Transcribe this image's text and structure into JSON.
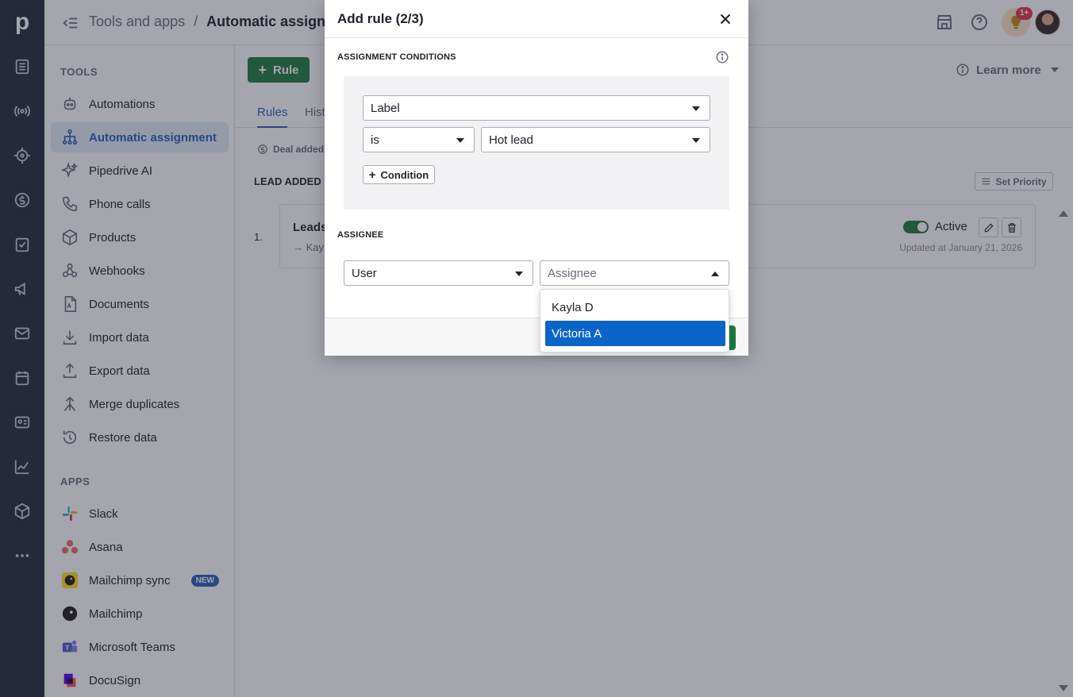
{
  "app": {
    "logo": "p"
  },
  "header": {
    "breadcrumb_parent": "Tools and apps",
    "breadcrumb_sep": "/",
    "breadcrumb_current": "Automatic assignmen",
    "notification_badge": "1+"
  },
  "sidenav": {
    "tools_heading": "TOOLS",
    "apps_heading": "APPS",
    "tools": [
      {
        "label": "Automations",
        "icon": "robot-icon"
      },
      {
        "label": "Automatic assignment",
        "icon": "assignment-tree-icon",
        "active": true
      },
      {
        "label": "Pipedrive AI",
        "icon": "sparkle-icon"
      },
      {
        "label": "Phone calls",
        "icon": "phone-icon"
      },
      {
        "label": "Products",
        "icon": "box-icon"
      },
      {
        "label": "Webhooks",
        "icon": "webhook-icon"
      },
      {
        "label": "Documents",
        "icon": "document-icon"
      },
      {
        "label": "Import data",
        "icon": "download-icon"
      },
      {
        "label": "Export data",
        "icon": "upload-icon"
      },
      {
        "label": "Merge duplicates",
        "icon": "merge-icon"
      },
      {
        "label": "Restore data",
        "icon": "restore-icon"
      }
    ],
    "apps": [
      {
        "label": "Slack",
        "icon": "slack-icon"
      },
      {
        "label": "Asana",
        "icon": "asana-icon"
      },
      {
        "label": "Mailchimp sync",
        "icon": "mailchimp-icon",
        "badge": "NEW"
      },
      {
        "label": "Mailchimp",
        "icon": "mailchimp-icon"
      },
      {
        "label": "Microsoft Teams",
        "icon": "teams-icon"
      },
      {
        "label": "DocuSign",
        "icon": "docusign-icon"
      }
    ]
  },
  "main": {
    "add_rule_label": "Rule",
    "learn_more": "Learn more",
    "tabs": [
      "Rules",
      "Hist"
    ],
    "deal_added": "Deal added",
    "lead_added_heading": "LEAD ADDED",
    "set_priority": "Set Priority",
    "rule": {
      "number": "1.",
      "title": "Leads",
      "sub": "Kay",
      "status": "Active",
      "updated": "Updated at January 21, 2026"
    }
  },
  "modal": {
    "title": "Add rule (2/3)",
    "conditions_heading": "ASSIGNMENT CONDITIONS",
    "field_select": "Label",
    "operator_select": "is",
    "value_select": "Hot lead",
    "add_condition": "Condition",
    "assignee_heading": "ASSIGNEE",
    "assignee_type": "User",
    "assignee_placeholder": "Assignee",
    "options": [
      "Kayla D",
      "Victoria A"
    ],
    "selected_option": "Victoria A"
  },
  "colors": {
    "rail": "#26283c",
    "accent_blue": "#2860b8",
    "primary_green": "#1f7a3e",
    "option_highlight": "#0b64c9"
  }
}
